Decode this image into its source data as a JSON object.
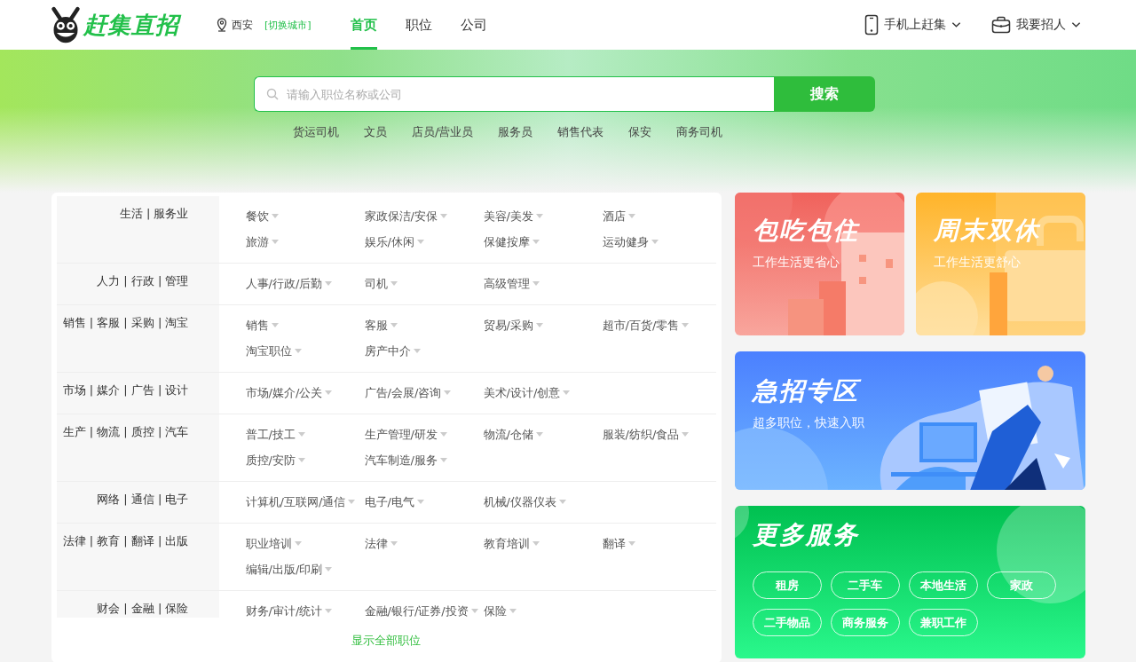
{
  "header": {
    "logo_text": "赶集直招",
    "location": {
      "city": "西安",
      "switch_label": "[切换城市]"
    },
    "nav": [
      {
        "label": "首页",
        "selected": true
      },
      {
        "label": "职位",
        "selected": false
      },
      {
        "label": "公司",
        "selected": false
      }
    ],
    "actions": [
      {
        "kind": "phone",
        "label": "手机上赶集"
      },
      {
        "kind": "bag",
        "label": "我要招人"
      }
    ]
  },
  "search": {
    "placeholder": "请输入职位名称或公司",
    "button": "搜索",
    "hot_keywords": [
      "货运司机",
      "文员",
      "店员/营业员",
      "服务员",
      "销售代表",
      "保安",
      "商务司机"
    ]
  },
  "categories": [
    {
      "title": "生活 | 服务业",
      "jobs": [
        "餐饮",
        "家政保洁/安保",
        "美容/美发",
        "酒店",
        "旅游",
        "娱乐/休闲",
        "保健按摩",
        "运动健身"
      ]
    },
    {
      "title": "人力 | 行政 | 管理",
      "jobs": [
        "人事/行政/后勤",
        "司机",
        "高级管理"
      ]
    },
    {
      "title": "销售 | 客服 | 采购 | 淘宝",
      "jobs": [
        "销售",
        "客服",
        "贸易/采购",
        "超市/百货/零售",
        "淘宝职位",
        "房产中介"
      ]
    },
    {
      "title": "市场 | 媒介 | 广告 | 设计",
      "jobs": [
        "市场/媒介/公关",
        "广告/会展/咨询",
        "美术/设计/创意"
      ]
    },
    {
      "title": "生产 | 物流 | 质控 | 汽车",
      "jobs": [
        "普工/技工",
        "生产管理/研发",
        "物流/仓储",
        "服装/纺织/食品",
        "质控/安防",
        "汽车制造/服务"
      ]
    },
    {
      "title": "网络 | 通信 | 电子",
      "jobs": [
        "计算机/互联网/通信",
        "电子/电气",
        "机械/仪器仪表"
      ]
    },
    {
      "title": "法律 | 教育 | 翻译 | 出版",
      "jobs": [
        "职业培训",
        "法律",
        "教育培训",
        "翻译",
        "编辑/出版/印刷"
      ]
    },
    {
      "title": "财会 | 金融 | 保险",
      "jobs": [
        "财务/审计/统计",
        "金融/银行/证券/投资",
        "保险"
      ]
    }
  ],
  "show_all": "显示全部职位",
  "promos": [
    {
      "kind": "red",
      "title": "包吃包住",
      "subtitle": "工作生活更省心"
    },
    {
      "kind": "orange",
      "title": "周末双休",
      "subtitle": "工作生活更舒心"
    },
    {
      "kind": "blue",
      "title": "急招专区",
      "subtitle": "超多职位，快速入职"
    }
  ],
  "services": {
    "title": "更多服务",
    "tags": [
      "租房",
      "二手车",
      "本地生活",
      "家政",
      "二手物品",
      "商务服务",
      "兼职工作"
    ]
  }
}
